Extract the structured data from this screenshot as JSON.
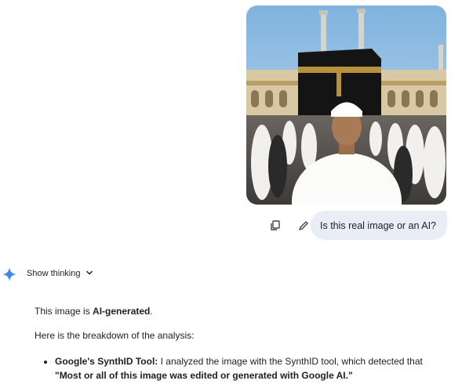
{
  "user_message": {
    "photo_alt": "Photo of a man in white ihram clothing at the Kaaba",
    "question": "Is this real image or an AI?",
    "copy_icon": "copy-icon",
    "edit_icon": "pencil-icon"
  },
  "assistant": {
    "logo_icon": "gemini-sparkle-icon",
    "show_thinking_label": "Show thinking",
    "thinking_chevron": "chevron-down-icon",
    "verdict_prefix": "This image is ",
    "verdict_bold": "AI-generated",
    "verdict_suffix": ".",
    "breakdown_intro": "Here is the breakdown of the analysis:",
    "bullets": [
      {
        "title": "Google's SynthID Tool:",
        "text": " I analyzed the image with the SynthID tool, which detected that ",
        "quote": "\"Most or all of this image was edited or generated with Google AI.\""
      }
    ]
  },
  "colors": {
    "bubble_bg": "#e9eef6",
    "text": "#1f1f1f",
    "sparkle": "#4285f4"
  }
}
